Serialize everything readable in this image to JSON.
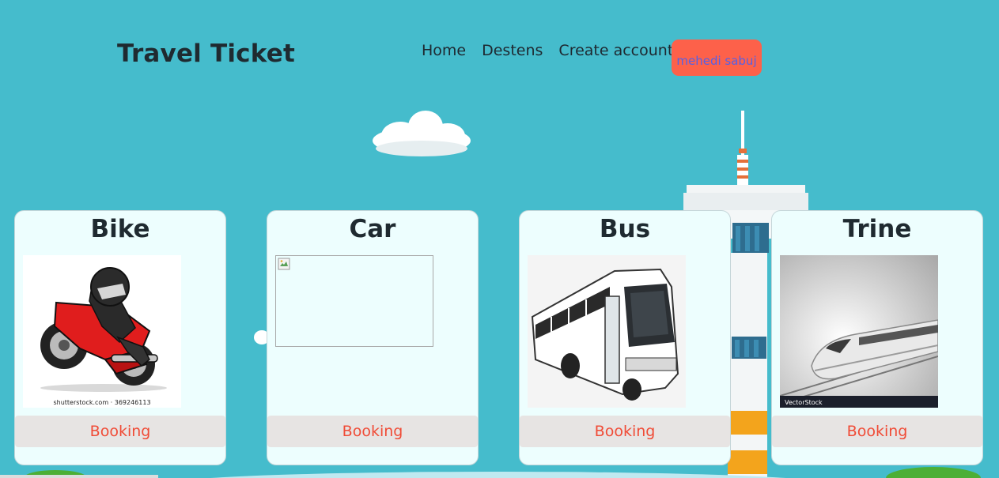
{
  "header": {
    "brand": "Travel Ticket",
    "nav": [
      "Home",
      "Destens",
      "Create account"
    ],
    "user_button": "mehedi sabuj"
  },
  "cards": [
    {
      "title": "Bike",
      "image": "motorbike-rider-illustration",
      "caption": "shutterstock.com · 369246113",
      "button": "Booking"
    },
    {
      "title": "Car",
      "image": "broken-image",
      "button": "Booking"
    },
    {
      "title": "Bus",
      "image": "white-coach-bus",
      "button": "Booking"
    },
    {
      "title": "Trine",
      "image": "high-speed-train",
      "caption": "VectorStock",
      "button": "Booking"
    }
  ],
  "colors": {
    "background": "#45bccc",
    "card": "#edfefe",
    "user_button": "#fd614a",
    "user_button_text": "#5561e6",
    "booking_button": "#e7e4e3",
    "booking_text": "#f04b36"
  }
}
